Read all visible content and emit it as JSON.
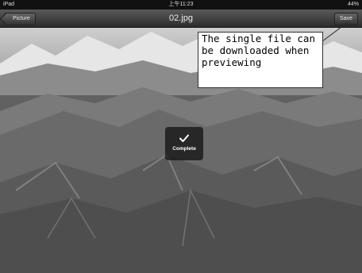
{
  "status_bar": {
    "device": "iPad",
    "time": "上午11:23",
    "battery": "44%"
  },
  "nav": {
    "back_label": "Picture",
    "title": "02.jpg",
    "save_label": "Save"
  },
  "callout_text": "The single file can be downloaded when previewing",
  "hud": {
    "label": "Complete",
    "icon": "checkmark-icon"
  }
}
